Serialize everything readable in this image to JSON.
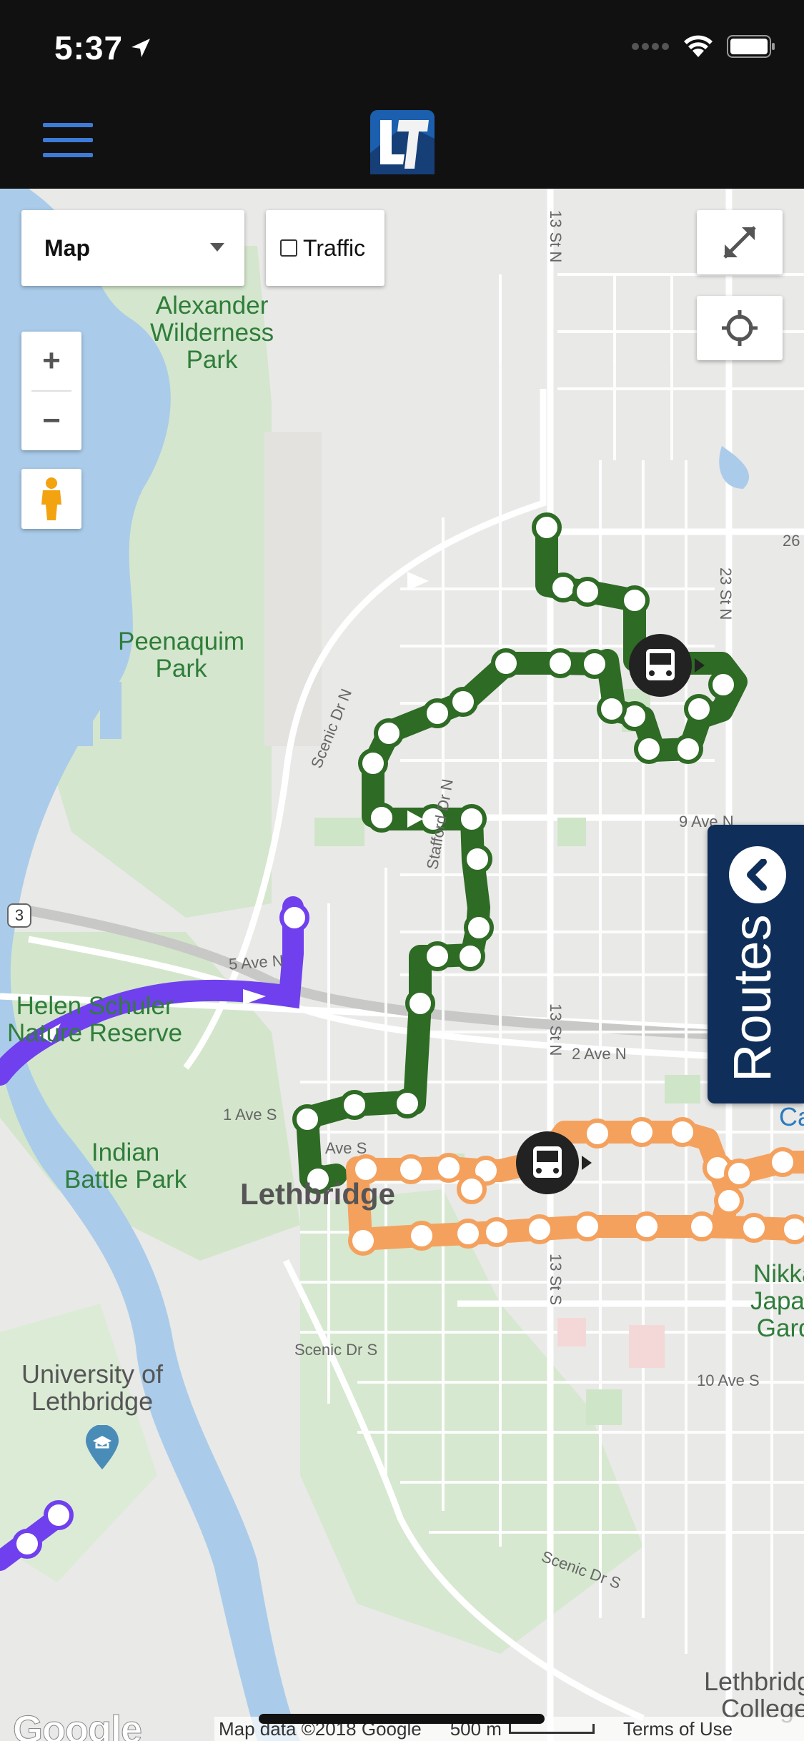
{
  "status_bar": {
    "time": "5:37"
  },
  "nav": {
    "logo_text": "LT"
  },
  "map_controls": {
    "map_type_selected": "Map",
    "traffic_label": "Traffic",
    "zoom_in_label": "+",
    "zoom_out_label": "−"
  },
  "routes_tab": {
    "label": "Routes"
  },
  "map_labels": {
    "parks": {
      "alexander": "Alexander\nWilderness\nPark",
      "peenaquim": "Peenaquim\nPark",
      "helen_schuler": "Helen Schuler\nNature Reserve",
      "indian_battle": "Indian\nBattle Park",
      "nikka": "Nikka\nJapan\nGard"
    },
    "streets": {
      "thirteen_st_n_top": "13 St N",
      "thirteen_st_n_mid": "13 St N",
      "thirteen_st_s": "13 St S",
      "twentythree_st_n": "23 St N",
      "scenic_dr_n": "Scenic Dr N",
      "stafford_dr_n": "Stafford Dr N",
      "nine_ave_n": "9 Ave N",
      "five_ave_n": "5 Ave N",
      "two_ave_n": "2 Ave N",
      "one_ave_s": "1 Ave S",
      "ave_s": "Ave S",
      "scenic_dr_s": "Scenic Dr S",
      "scenic_dr_s2": "Scenic Dr S",
      "ten_ave_s": "10 Ave S",
      "twentysix": "26",
      "highway_3": "3"
    },
    "city": "Lethbridge",
    "university": "University of\nLethbridge",
    "college": "Lethbridge\nCollege",
    "ca_partial": "Ca"
  },
  "attribution": {
    "google": "Google",
    "map_data": "Map data ©2018 Google",
    "scale": "500 m",
    "terms": "Terms of Use"
  },
  "colors": {
    "green_route": "#2e6b24",
    "orange_route": "#f5a15e",
    "purple_route": "#7040ee",
    "routes_tab": "#0f2f5a",
    "water": "#a8c8e8",
    "park": "#c8dfc4"
  }
}
